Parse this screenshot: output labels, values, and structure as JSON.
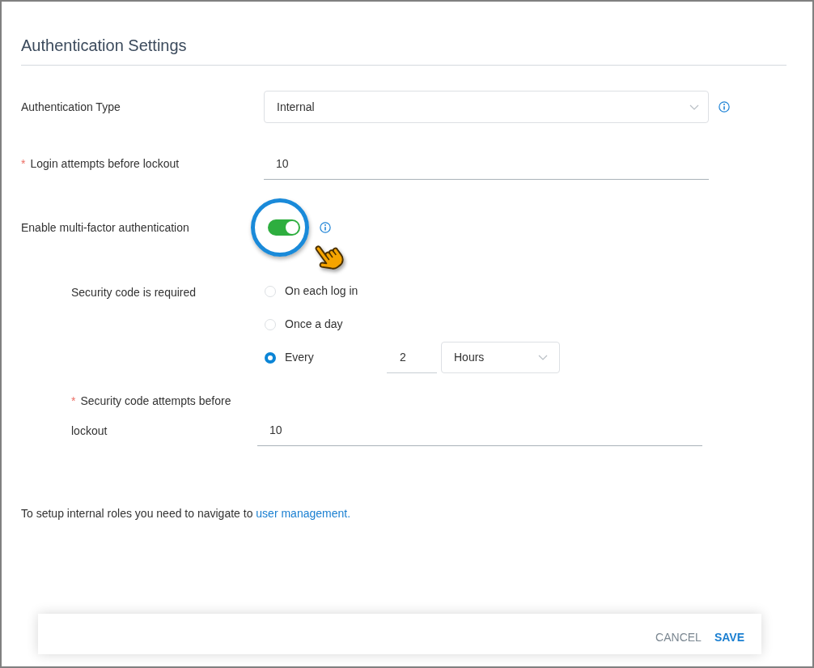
{
  "title": "Authentication Settings",
  "fields": [
    {
      "kind": "select",
      "label": "Authentication Type",
      "value": "Internal",
      "info": true
    },
    {
      "kind": "text",
      "required_mark": "*",
      "label": "Login attempts before lockout",
      "value": "10"
    },
    {
      "kind": "toggle",
      "label": "Enable multi-factor authentication",
      "on": true,
      "info": true,
      "highlighted": true,
      "cursor": true
    }
  ],
  "mfa": {
    "label": "Security code is required",
    "options": [
      {
        "label": "On each log in",
        "selected": false
      },
      {
        "label": "Once a day",
        "selected": false
      },
      {
        "label": "Every",
        "selected": true,
        "interval": {
          "value": "2",
          "unit": "Hours"
        }
      }
    ],
    "attempts": {
      "required_mark": "*",
      "label": "Security code attempts before lockout",
      "value": "10"
    }
  },
  "note": {
    "text": "To setup internal roles you need to navigate to ",
    "link": "user management."
  },
  "buttons": [
    {
      "label": "CANCEL",
      "kind": "secondary"
    },
    {
      "label": "SAVE",
      "kind": "primary"
    }
  ]
}
